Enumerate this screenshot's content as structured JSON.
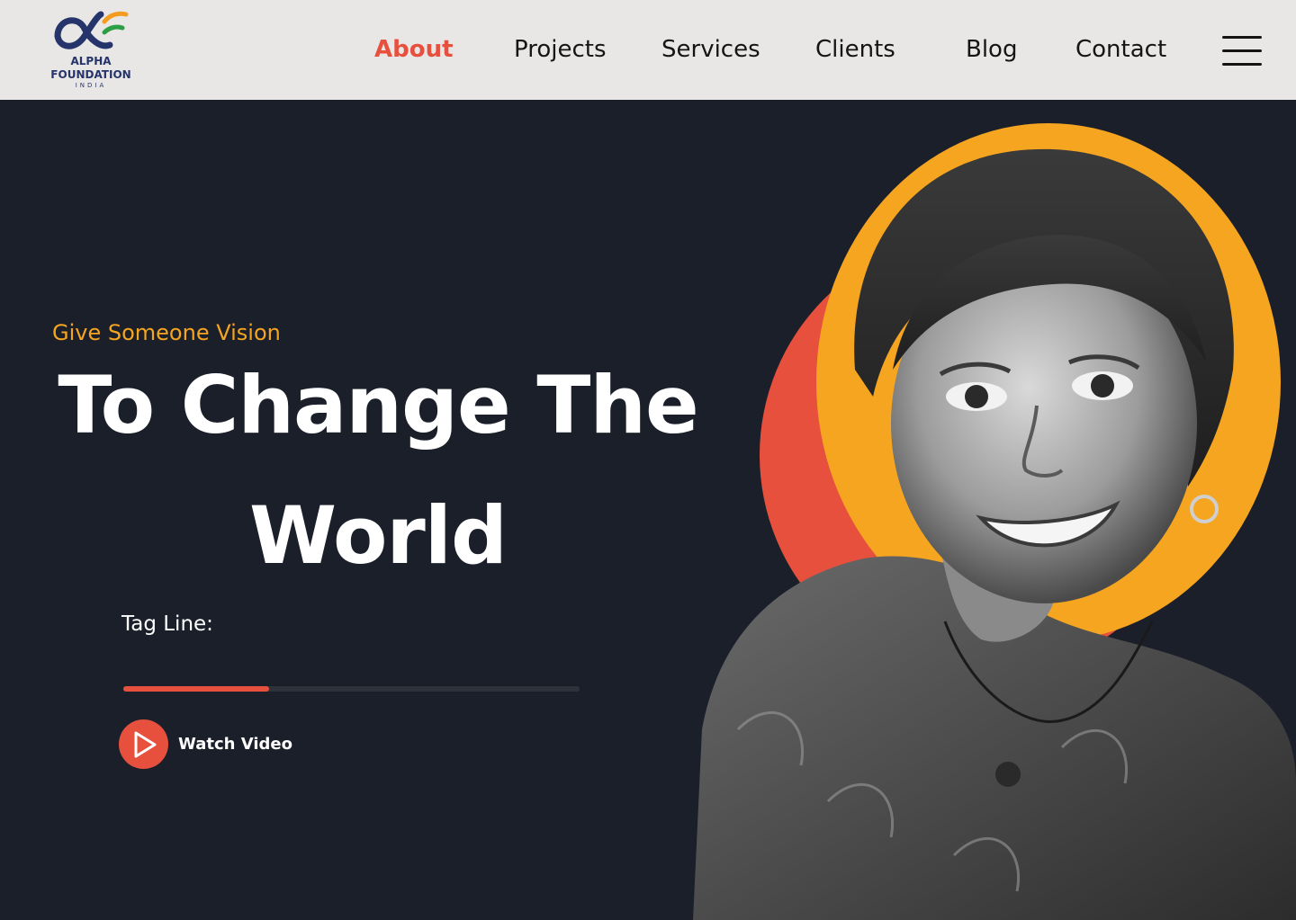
{
  "brand": {
    "line1": "ALPHA",
    "line2": "FOUNDATION",
    "line3": "INDIA",
    "navy": "#25346a",
    "saffron": "#f39c1f",
    "green": "#2e9e44"
  },
  "nav": {
    "items": [
      {
        "label": "About",
        "active": true
      },
      {
        "label": "Projects",
        "active": false
      },
      {
        "label": "Services",
        "active": false
      },
      {
        "label": "Clients",
        "active": false
      },
      {
        "label": "Blog",
        "active": false
      },
      {
        "label": "Contact",
        "active": false
      }
    ],
    "menu_icon": "hamburger-menu-icon",
    "active_color": "#e8503e"
  },
  "hero": {
    "kicker": "Give Someone Vision",
    "title_line1": "To Change The",
    "title_line2": "World",
    "tagline": "Tag Line:",
    "progress": 0.32,
    "watch_label": "Watch  Video",
    "play_icon": "play-icon",
    "background": "#1a1f2a",
    "accent_orange": "#f5a51f",
    "accent_red": "#e8503e"
  }
}
